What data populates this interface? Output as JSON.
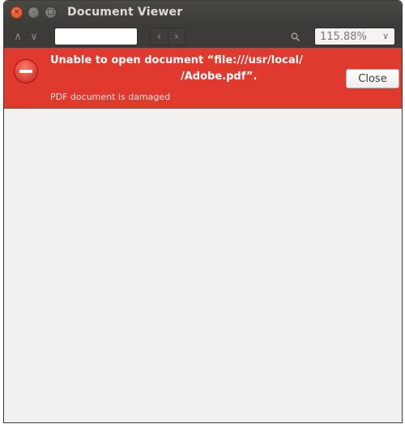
{
  "window": {
    "title": "Document Viewer"
  },
  "titlebar": {
    "close_glyph": "×",
    "minimize_glyph": "–",
    "maximize_glyph": "□"
  },
  "toolbar": {
    "prev_glyph": "∧",
    "next_glyph": "∨",
    "search_value": "",
    "page_back_glyph": "‹",
    "page_forward_glyph": "›",
    "search_icon": "search-icon",
    "zoom_value": "115.88%",
    "zoom_chevron": "∨"
  },
  "error": {
    "icon": "error-icon",
    "title_line1": "Unable to open document “file:///usr/local/",
    "title_line2": "/Adobe.pdf”.",
    "detail": "PDF document is damaged",
    "close_label": "Close",
    "colors": {
      "background": "#e03a2e",
      "text": "#ffffff"
    }
  }
}
